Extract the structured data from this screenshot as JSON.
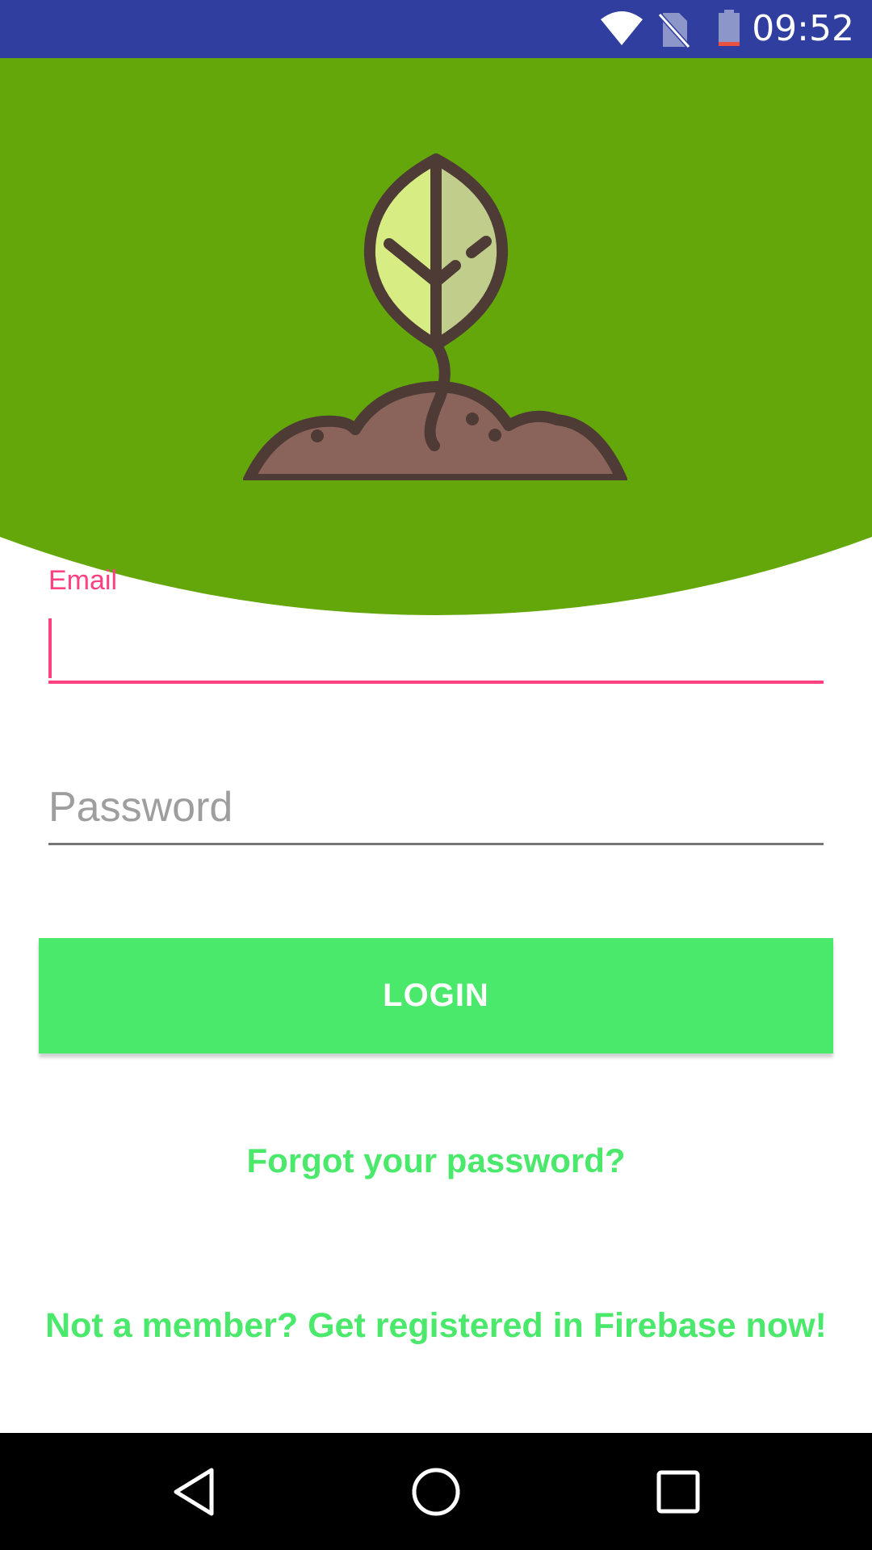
{
  "status_bar": {
    "time": "09:52",
    "icons": [
      "wifi-icon",
      "no-sim-icon",
      "battery-icon"
    ]
  },
  "header": {
    "background_color": "#64a70b",
    "logo_icon": "sprout-icon"
  },
  "form": {
    "email_label": "Email",
    "email_value": "",
    "password_placeholder": "Password",
    "accent_color": "#ff4081"
  },
  "actions": {
    "login_label": "LOGIN",
    "forgot_password_label": "Forgot your password?",
    "register_label": "Not a member? Get registered in Firebase now!",
    "button_color": "#4ae86b"
  },
  "nav_bar": {
    "icons": [
      "back-icon",
      "home-icon",
      "recents-icon"
    ]
  }
}
